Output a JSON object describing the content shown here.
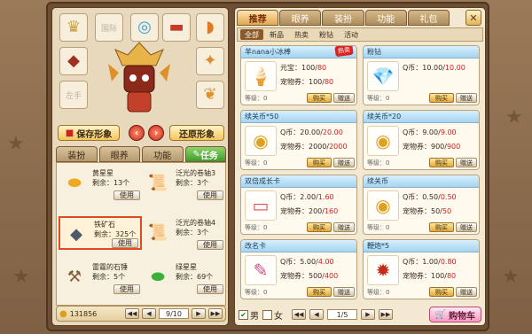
{
  "left": {
    "slots": {
      "head_label": "",
      "waist_label": "国际",
      "hand_label": "左手"
    },
    "buttons": {
      "save": "保存形象",
      "restore": "还原形象"
    },
    "tabs": [
      "装扮",
      "眼养",
      "功能",
      "任务"
    ],
    "items": [
      {
        "name": "黄星星",
        "count": "剩余：13个",
        "use": "使用"
      },
      {
        "name": "泛光的卷轴3",
        "count": "剩余：3个",
        "use": "使用"
      },
      {
        "name": "铁矿石",
        "count": "剩余：325个",
        "use": "使用"
      },
      {
        "name": "泛光的卷轴4",
        "count": "剩余：3个",
        "use": "使用"
      },
      {
        "name": "雷霆的石锤",
        "count": "剩余：5个",
        "use": "使用"
      },
      {
        "name": "绿星星",
        "count": "剩余：69个",
        "use": "使用"
      }
    ],
    "pager": {
      "gold": "131856",
      "page": "9/10"
    }
  },
  "right": {
    "tabs": [
      "推荐",
      "眼养",
      "装扮",
      "功能",
      "礼包"
    ],
    "close": "✕",
    "subtabs": [
      "全部",
      "新品",
      "热卖",
      "粉钻",
      "活动"
    ],
    "products": [
      {
        "title": "羊nana小冰棒",
        "hot": "热卖",
        "l1a": "元宝：",
        "l1b": "100/",
        "l1c": "80",
        "l2a": "宠物券：",
        "l2b": "100/",
        "l2c": "80",
        "lv": "等级：0",
        "buy": "购买",
        "give": "赠送"
      },
      {
        "title": "粉钻",
        "hot": "",
        "l1a": "Q币：",
        "l1b": "10.00/",
        "l1c": "10.00",
        "l2a": "",
        "l2b": "",
        "l2c": "",
        "lv": "等级：0",
        "buy": "购买",
        "give": "赠送"
      },
      {
        "title": "续关币*50",
        "hot": "",
        "l1a": "Q币：",
        "l1b": "20.00/",
        "l1c": "20.00",
        "l2a": "宠物券：",
        "l2b": "2000/",
        "l2c": "2000",
        "lv": "等级：0",
        "buy": "购买",
        "give": "赠送"
      },
      {
        "title": "续关币*20",
        "hot": "",
        "l1a": "Q币：",
        "l1b": "9.00/",
        "l1c": "9.00",
        "l2a": "宠物券：",
        "l2b": "900/",
        "l2c": "900",
        "lv": "等级：0",
        "buy": "购买",
        "give": "赠送"
      },
      {
        "title": "双倍成长卡",
        "hot": "",
        "l1a": "Q币：",
        "l1b": "2.00/",
        "l1c": "1.60",
        "l2a": "宠物券：",
        "l2b": "200/",
        "l2c": "160",
        "lv": "等级：0",
        "buy": "购买",
        "give": "赠送"
      },
      {
        "title": "续关币",
        "hot": "",
        "l1a": "Q币：",
        "l1b": "0.50/",
        "l1c": "0.50",
        "l2a": "宠物券：",
        "l2b": "50/",
        "l2c": "50",
        "lv": "等级：0",
        "buy": "购买",
        "give": "赠送"
      },
      {
        "title": "改名卡",
        "hot": "",
        "l1a": "Q币：",
        "l1b": "5.00/",
        "l1c": "4.00",
        "l2a": "宠物券：",
        "l2b": "500/",
        "l2c": "400",
        "lv": "等级：0",
        "buy": "购买",
        "give": "赠送"
      },
      {
        "title": "鞭炮*5",
        "hot": "",
        "l1a": "Q币：",
        "l1b": "1.00/",
        "l1c": "0.80",
        "l2a": "宠物券：",
        "l2b": "100/",
        "l2c": "80",
        "lv": "等级：0",
        "buy": "购买",
        "give": "赠送"
      }
    ],
    "footer": {
      "male": "男",
      "female": "女",
      "page": "1/5",
      "cart": "购物车"
    }
  }
}
